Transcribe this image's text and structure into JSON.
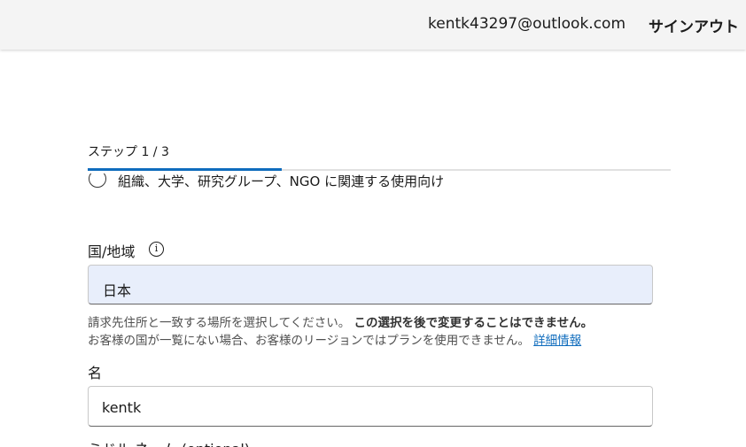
{
  "header": {
    "email": "kentk43297@outlook.com",
    "sign_out": "サインアウト"
  },
  "stepper": {
    "label": "ステップ 1 / 3",
    "current_step": 1,
    "total_steps": 3,
    "progress_fraction": 0.333
  },
  "form": {
    "partial_radio_label": "組織、大学、研究グループ、NGO に関連する使用向け",
    "country": {
      "label": "国/地域",
      "value": "日本",
      "help_line1": "請求先住所と一致する場所を選択してください。",
      "help_line1_bold": "この選択を後で変更することはできません。",
      "help_line2": "お客様の国が一覧にない場合、お客様のリージョンではプランを使用できません。",
      "help_link": "詳細情報"
    },
    "first_name": {
      "label": "名",
      "value": "kentk"
    },
    "middle_name": {
      "label": "ミドル ネーム (optional)"
    }
  },
  "colors": {
    "accent": "#0f6cbd",
    "header_bg": "#f4f4f4",
    "select_bg": "#e8eefb"
  }
}
